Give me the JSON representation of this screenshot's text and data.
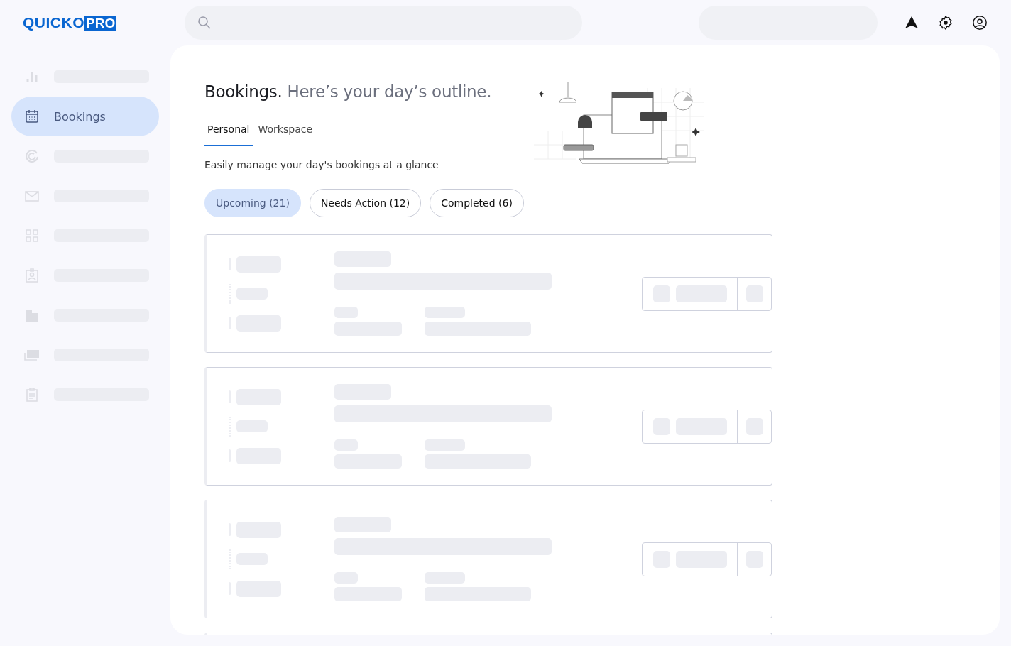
{
  "logo": {
    "name": "QUICKO",
    "badge": "PRO"
  },
  "search": {
    "kind": "search"
  },
  "sidebar": {
    "items": [
      {
        "kind": "skeleton",
        "selected": false
      },
      {
        "kind": "link",
        "label": "Bookings",
        "selected": true
      },
      {
        "kind": "skeleton",
        "selected": false
      },
      {
        "kind": "skeleton",
        "selected": false
      },
      {
        "kind": "skeleton",
        "selected": false
      },
      {
        "kind": "skeleton",
        "selected": false
      },
      {
        "kind": "skeleton",
        "selected": false
      },
      {
        "kind": "skeleton",
        "selected": false
      },
      {
        "kind": "skeleton",
        "selected": false
      }
    ]
  },
  "header": {
    "title": "Bookings.",
    "subtitle": "Here’s your day’s outline."
  },
  "tabs": [
    {
      "label": "Personal",
      "selected": true
    },
    {
      "label": "Workspace",
      "selected": false
    }
  ],
  "description": "Easily manage your day's bookings at a glance",
  "filters": [
    {
      "label": "Upcoming (21)",
      "selected": true
    },
    {
      "label": "Needs Action (12)",
      "selected": false
    },
    {
      "label": "Completed (6)",
      "selected": false
    }
  ],
  "booking_cards": [
    {
      "kind": "skeleton"
    },
    {
      "kind": "skeleton"
    },
    {
      "kind": "skeleton"
    },
    {
      "kind": "skeleton-edge"
    }
  ]
}
